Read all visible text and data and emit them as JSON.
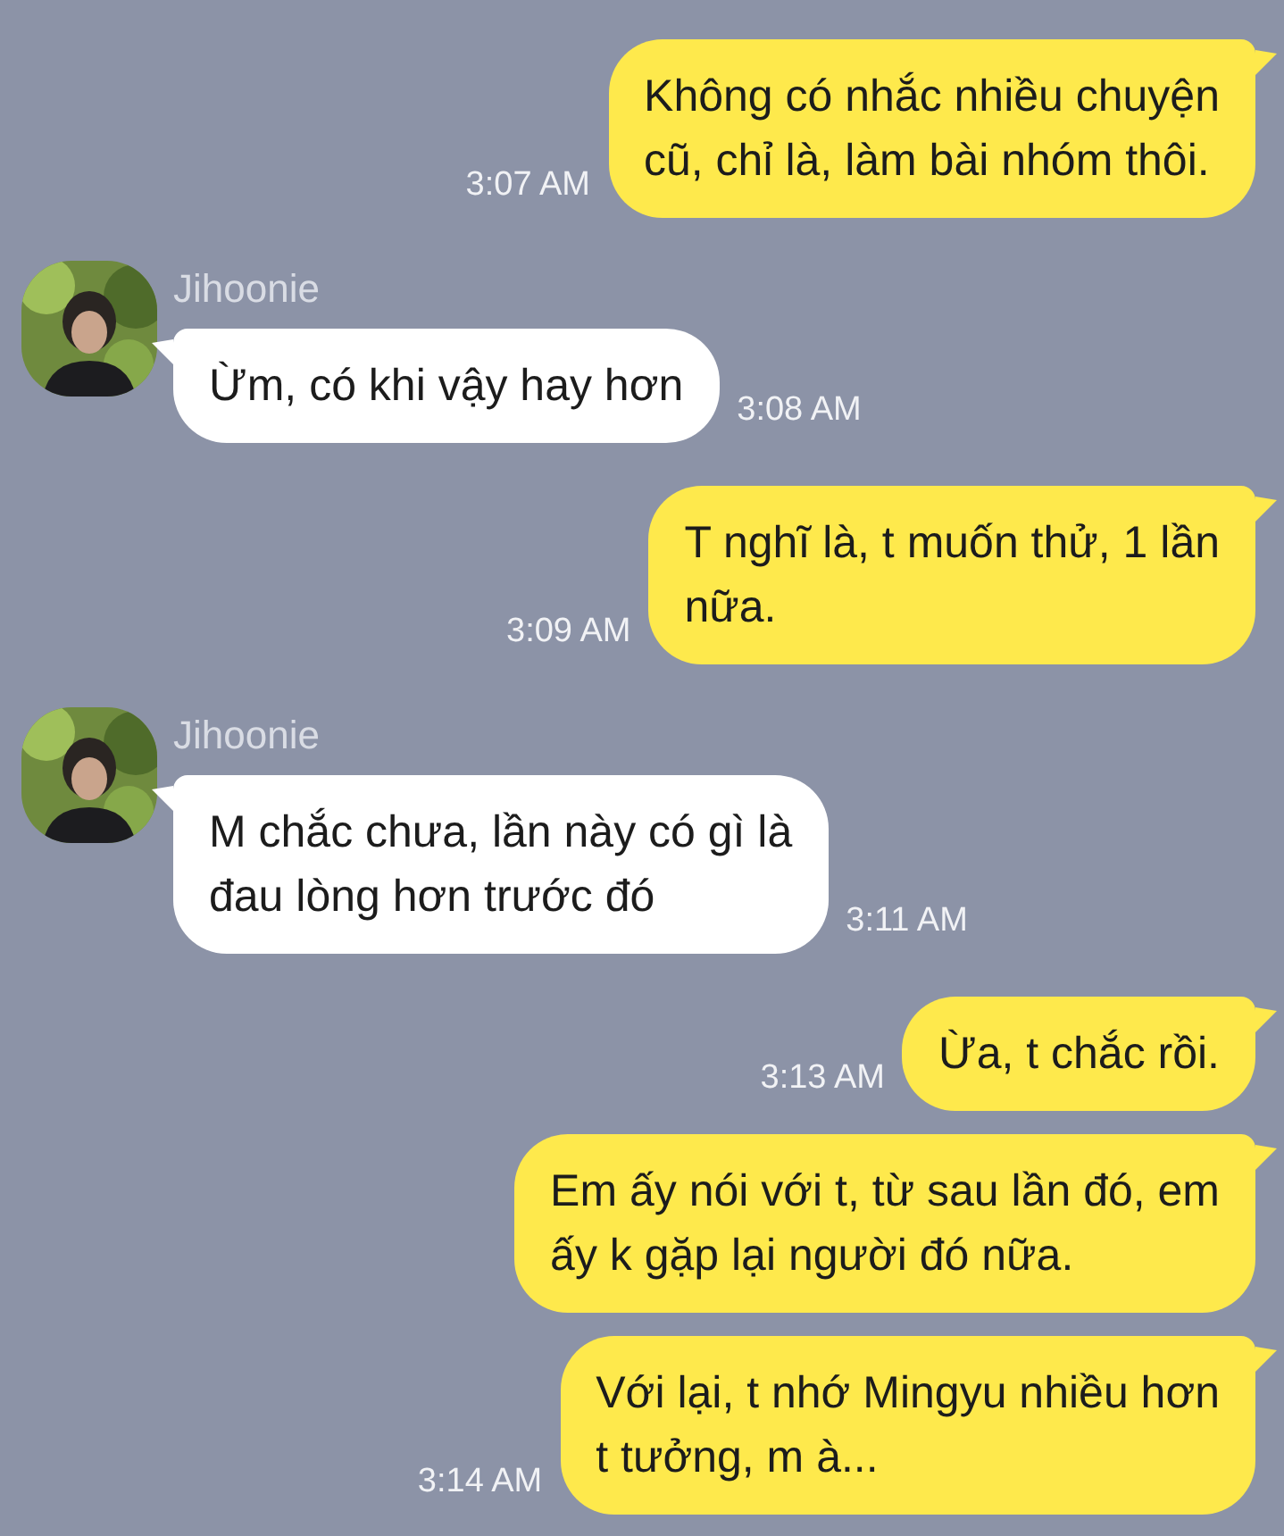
{
  "messages": [
    {
      "kind": "outgoing",
      "text": "Không có nhắc nhiều chuyện\ncũ, chỉ là, làm bài nhóm thôi.",
      "time": "3:07 AM"
    },
    {
      "kind": "incoming",
      "sender": "Jihoonie",
      "text": "Ừm, có khi vậy hay hơn",
      "time": "3:08 AM"
    },
    {
      "kind": "outgoing",
      "text": "T nghĩ là, t muốn thử, 1 lần\nnữa.",
      "time": "3:09 AM"
    },
    {
      "kind": "incoming",
      "sender": "Jihoonie",
      "text": "M chắc chưa, lần này có gì là\nđau lòng hơn trước đó",
      "time": "3:11 AM"
    },
    {
      "kind": "outgoing",
      "text": "Ừa, t chắc rồi.",
      "time": "3:13 AM"
    },
    {
      "kind": "outgoing",
      "text": "Em ấy nói với t, từ sau lần đó, em\nấy k gặp lại người đó nữa."
    },
    {
      "kind": "outgoing",
      "text": "Với lại, t nhớ Mingyu nhiều hơn\nt tưởng, m à...",
      "time": "3:14 AM"
    }
  ]
}
